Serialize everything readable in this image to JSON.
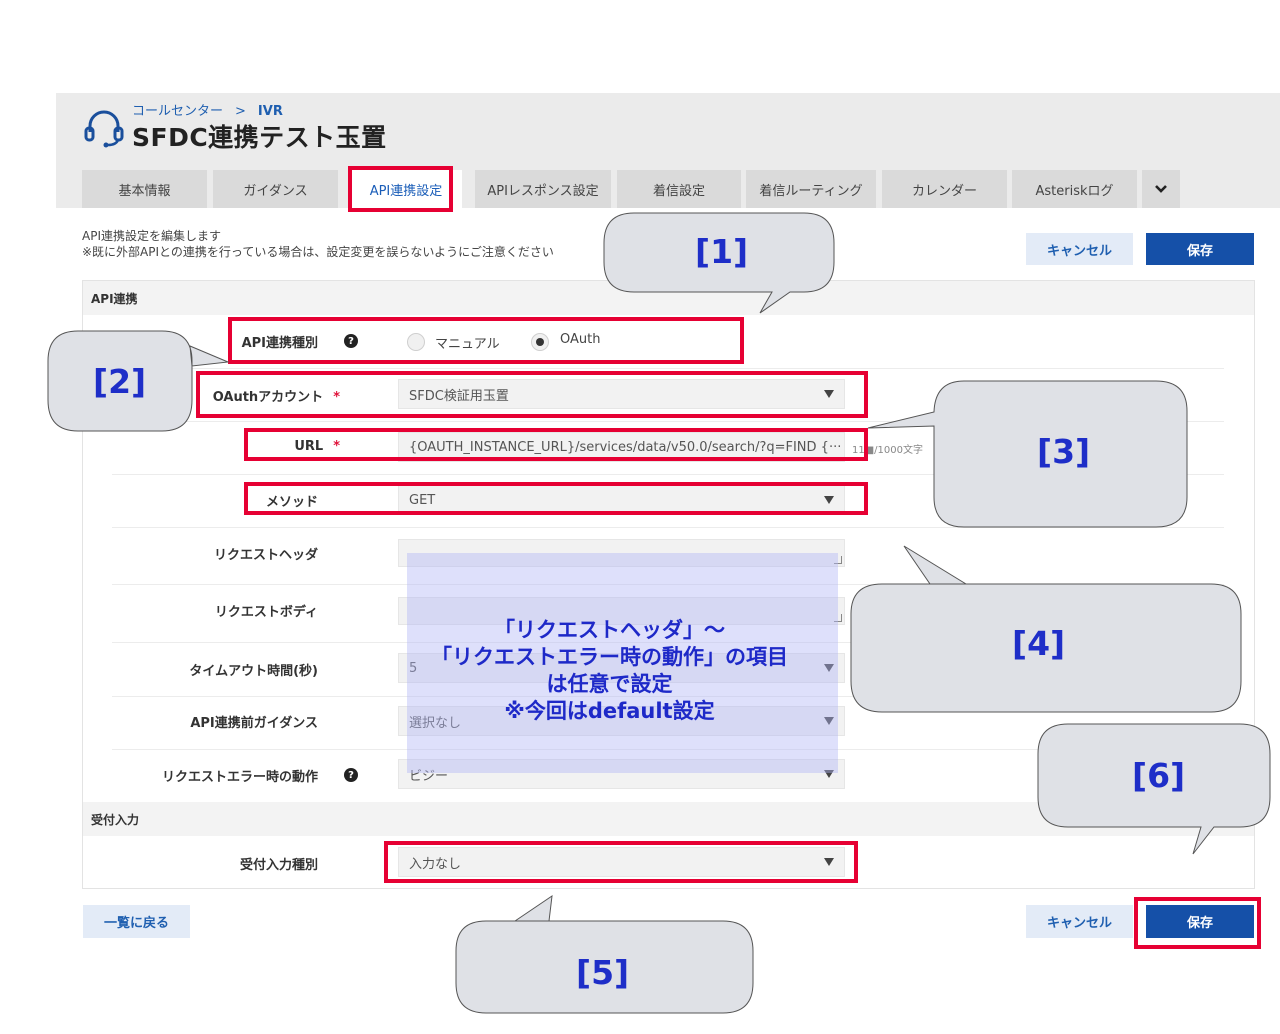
{
  "breadcrumb": {
    "parent": "コールセンター",
    "separator": ">",
    "current": "IVR"
  },
  "page_title": "SFDC連携テスト玉置",
  "tabs": [
    {
      "label": "基本情報",
      "active": false
    },
    {
      "label": "ガイダンス",
      "active": false
    },
    {
      "label": "API連携設定",
      "active": true
    },
    {
      "label": "APIレスポンス設定",
      "active": false
    },
    {
      "label": "着信設定",
      "active": false
    },
    {
      "label": "着信ルーティング",
      "active": false
    },
    {
      "label": "カレンダー",
      "active": false
    },
    {
      "label": "Asteriskログ",
      "active": false
    }
  ],
  "tab_more_icon": "chevron-down-icon",
  "description": {
    "line1": "API連携設定を編集します",
    "line2": "※既に外部APIとの連携を行っている場合は、設定変更を誤らないようにご注意ください"
  },
  "actions": {
    "cancel": "キャンセル",
    "save": "保存",
    "back": "一覧に戻る"
  },
  "section_api": {
    "title": "API連携",
    "type_label": "API連携種別",
    "type_options": [
      "マニュアル",
      "OAuth"
    ],
    "type_selected": "OAuth",
    "oauth_account_label": "OAuthアカウント",
    "oauth_account_value": "SFDC検証用玉置",
    "url_label": "URL",
    "url_value": "{OAUTH_INSTANCE_URL}/services/data/v50.0/search/?q=FIND {···",
    "url_count": "11■/1000文字",
    "method_label": "メソッド",
    "method_value": "GET",
    "request_header_label": "リクエストヘッダ",
    "request_body_label": "リクエストボディ",
    "timeout_label": "タイムアウト時間(秒)",
    "timeout_value": "5",
    "pre_guidance_label": "API連携前ガイダンス",
    "pre_guidance_value": "選択なし",
    "error_action_label": "リクエストエラー時の動作",
    "error_action_value": "ビジー"
  },
  "required_mark": "*",
  "section_input": {
    "title": "受付入力",
    "type_label": "受付入力種別",
    "type_value": "入力なし"
  },
  "annotation": {
    "overlay_line1": "「リクエストヘッダ」～",
    "overlay_line2": "「リクエストエラー時の動作」の項目",
    "overlay_line3": "は任意で設定",
    "overlay_line4": "※今回はdefault設定",
    "labels": [
      "[1]",
      "[2]",
      "[3]",
      "[4]",
      "[5]",
      "[6]"
    ]
  },
  "colors": {
    "accent": "#1550a8",
    "highlight": "#e60033",
    "callout_text": "#1e2ec8",
    "callout_fill": "#dfe1e6"
  }
}
